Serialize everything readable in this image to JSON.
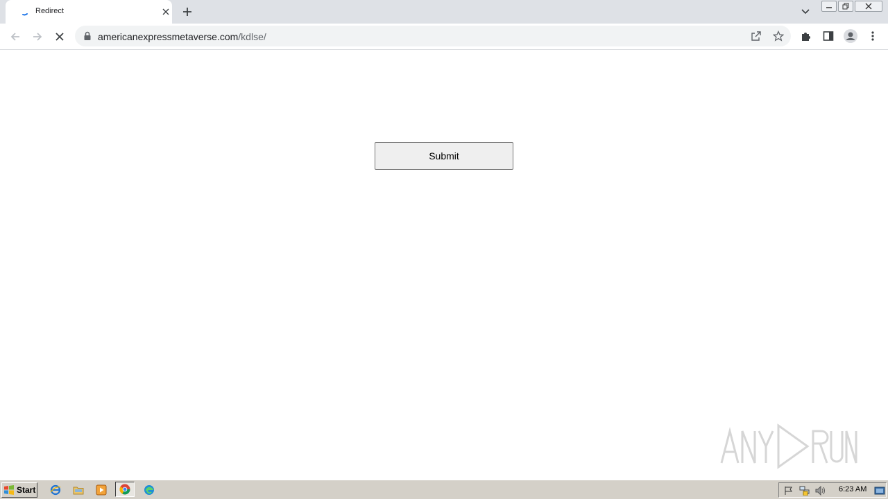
{
  "browser": {
    "tab": {
      "title": "Redirect",
      "favicon": "loading-spinner"
    },
    "url": {
      "domain": "americanexpressmetaverse.com",
      "path": "/kdlse/"
    },
    "icons": {
      "back": "arrow-left-icon",
      "forward": "arrow-right-icon",
      "stop": "close-icon",
      "lock": "lock-icon",
      "share": "share-icon",
      "bookmark": "star-icon",
      "extensions": "puzzle-icon",
      "side_panel": "side-panel-icon",
      "profile": "avatar-icon",
      "menu": "kebab-menu-icon"
    }
  },
  "page": {
    "submit_label": "Submit"
  },
  "watermark": {
    "text": "ANY RUN"
  },
  "taskbar": {
    "start_label": "Start",
    "clock": "6:23 AM",
    "quick_launch": [
      "internet-explorer-icon",
      "folder-icon",
      "media-player-icon",
      "chrome-icon",
      "edge-icon"
    ]
  },
  "colors": {
    "tabstrip": "#dee1e6",
    "omnibox": "#f1f3f4",
    "button_bg": "#efefef",
    "taskbar": "#d4d0c8"
  }
}
